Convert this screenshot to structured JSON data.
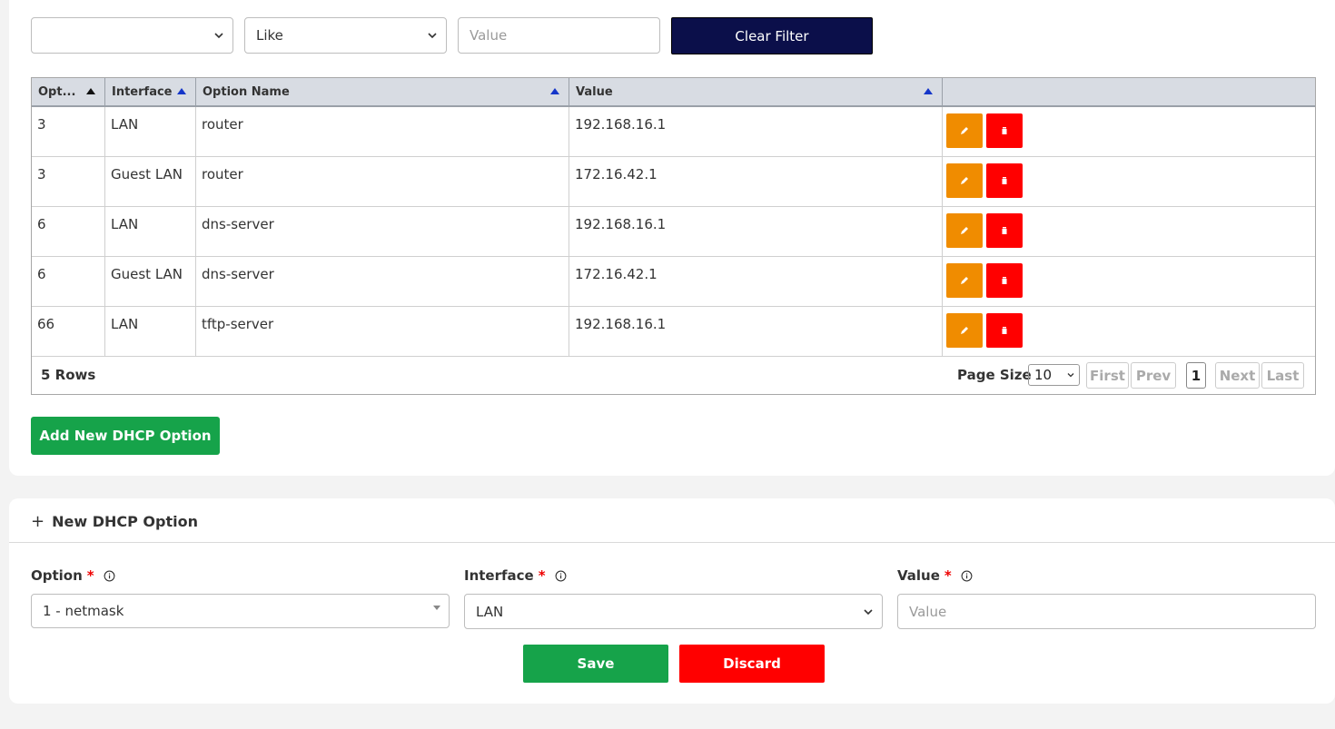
{
  "filter": {
    "column_value": "",
    "operator_value": "Like",
    "value_placeholder": "Value",
    "clear_label": "Clear Filter"
  },
  "table": {
    "columns": [
      "Opt...",
      "Interface",
      "Option Name",
      "Value"
    ],
    "rows": [
      {
        "option": "3",
        "interface": "LAN",
        "name": "router",
        "value": "192.168.16.1"
      },
      {
        "option": "3",
        "interface": "Guest LAN",
        "name": "router",
        "value": "172.16.42.1"
      },
      {
        "option": "6",
        "interface": "LAN",
        "name": "dns-server",
        "value": "192.168.16.1"
      },
      {
        "option": "6",
        "interface": "Guest LAN",
        "name": "dns-server",
        "value": "172.16.42.1"
      },
      {
        "option": "66",
        "interface": "LAN",
        "name": "tftp-server",
        "value": "192.168.16.1"
      }
    ],
    "edit_icon": "pencil-icon",
    "delete_icon": "trash-icon",
    "footer": {
      "rows_count": "5 Rows",
      "page_size_label": "Page Size",
      "page_size": "10",
      "first": "First",
      "prev": "Prev",
      "current_page": "1",
      "next": "Next",
      "last": "Last"
    }
  },
  "add_button_label": "Add New DHCP Option",
  "form": {
    "title": "New DHCP Option",
    "option_label": "Option",
    "option_value": "1 - netmask",
    "interface_label": "Interface",
    "interface_value": "LAN",
    "value_label": "Value",
    "value_placeholder": "Value",
    "required_mark": "*",
    "save_label": "Save",
    "discard_label": "Discard"
  },
  "colors": {
    "clear_filter": "#0b0f4a",
    "add": "#16a34a",
    "edit": "#f08c00",
    "delete": "#ff0000"
  }
}
